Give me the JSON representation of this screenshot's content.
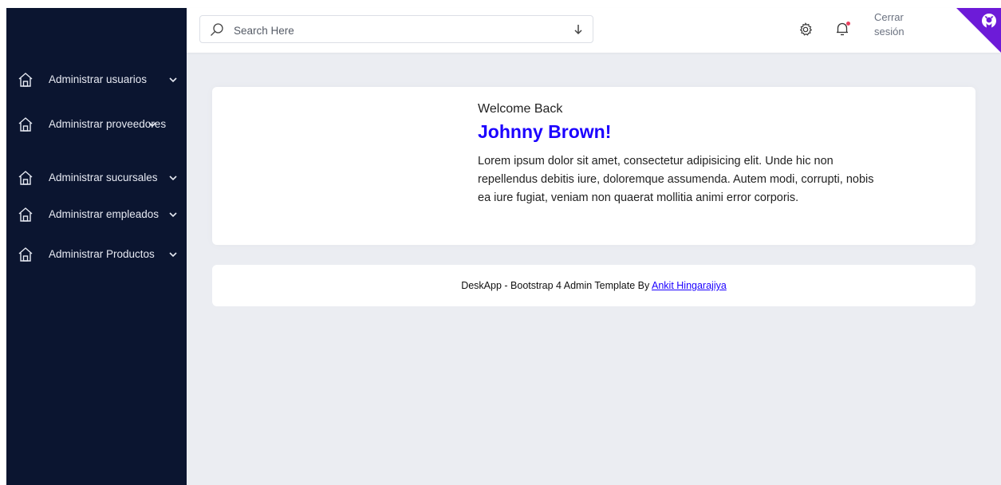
{
  "sidebar": {
    "items": [
      {
        "label": "Administrar usuarios",
        "icon": "house-icon"
      },
      {
        "label": "Administrar proveedores",
        "icon": "house-icon"
      },
      {
        "label": "Administrar sucursales",
        "icon": "house-icon"
      },
      {
        "label": "Administrar empleados",
        "icon": "house-icon"
      },
      {
        "label": "Administrar Productos",
        "icon": "house-icon"
      }
    ]
  },
  "header": {
    "search_placeholder": "Search Here",
    "logout_label": "Cerrar sesión",
    "icons": [
      "search-icon",
      "arrow-down-icon",
      "gear-icon",
      "bell-icon",
      "github-icon"
    ]
  },
  "welcome": {
    "greeting": "Welcome Back",
    "name": "Johnny Brown!",
    "text": "Lorem ipsum dolor sit amet, consectetur adipisicing elit. Unde hic non repellendus debitis iure, doloremque assumenda. Autem modi, corrupti, nobis ea iure fugiat, veniam non quaerat mollitia animi error corporis."
  },
  "footer": {
    "text": "DeskApp - Bootstrap 4 Admin Template By ",
    "link_text": "Ankit Hingarajiya"
  },
  "colors": {
    "sidebar_bg": "#0b1530",
    "accent": "#1b00ff",
    "corner": "#6d1bd8",
    "content_bg": "#ebedf2",
    "notification_dot": "#e83e5c"
  }
}
